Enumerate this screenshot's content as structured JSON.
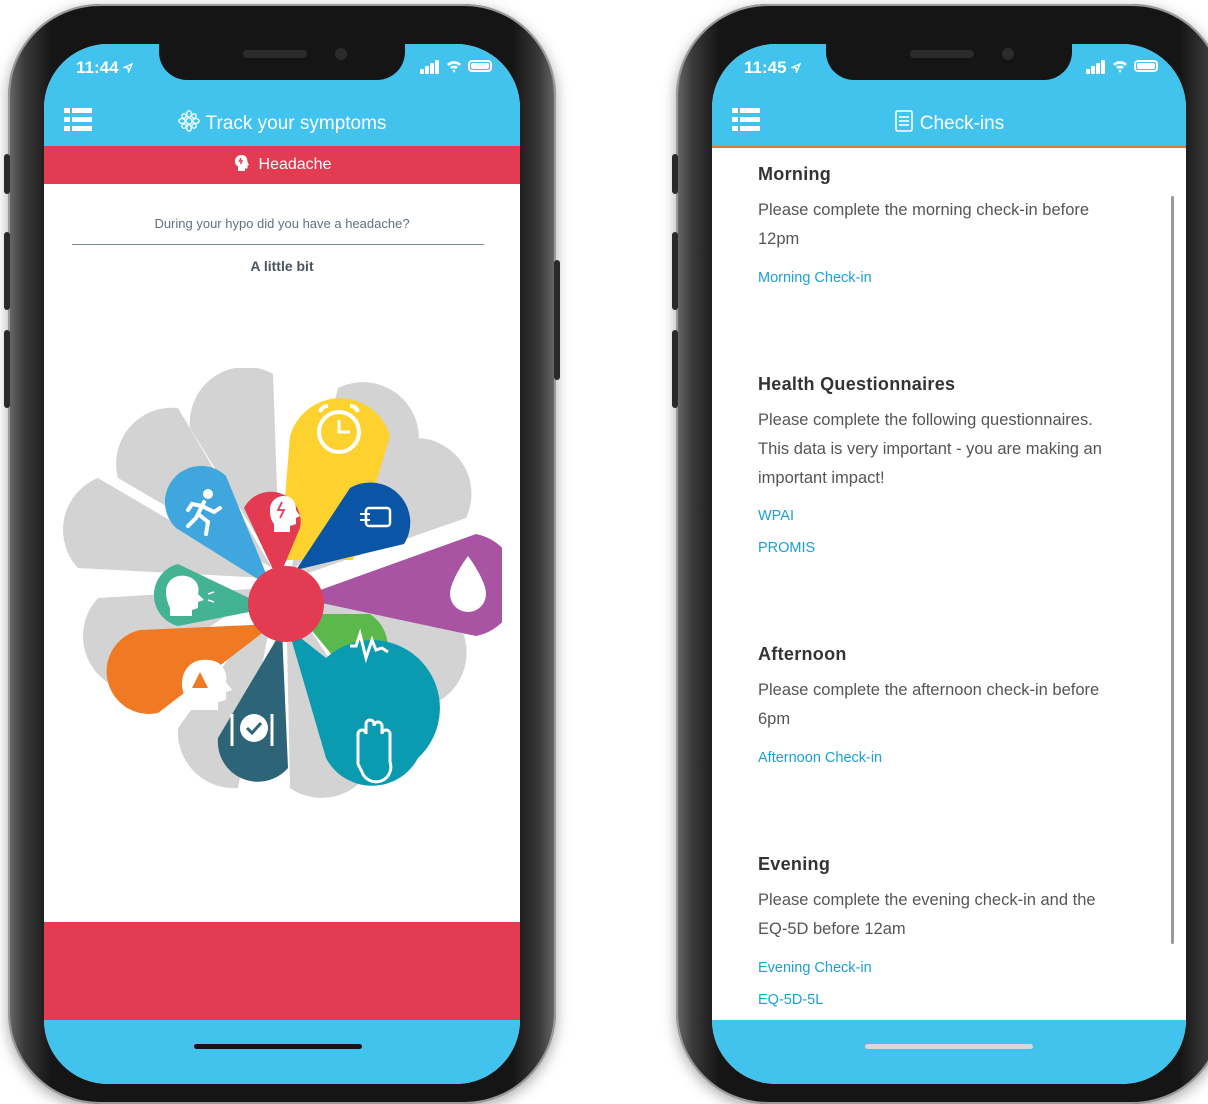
{
  "phone_left": {
    "status_time": "11:44",
    "header_title": "Track your symptoms",
    "subheader_title": "Headache",
    "question": "During your hypo did you have a headache?",
    "answer": "A little bit",
    "symptom_wheel": {
      "center_color": "#e23b52",
      "petals": [
        {
          "icon": "alarm-clock-icon",
          "color": "#fdd22e"
        },
        {
          "icon": "hand-tremor-icon",
          "color": "#0a55a5"
        },
        {
          "icon": "blood-drop-icon",
          "color": "#a953a3"
        },
        {
          "icon": "heartbeat-icon",
          "color": "#5bb84a"
        },
        {
          "icon": "sweating-hand-icon",
          "color": "#0b9bb0"
        },
        {
          "icon": "hunger-plate-icon",
          "color": "#2e6477"
        },
        {
          "icon": "confusion-warning-icon",
          "color": "#f07a24"
        },
        {
          "icon": "speech-icon",
          "color": "#44b393"
        },
        {
          "icon": "running-person-icon",
          "color": "#3fa7dd"
        },
        {
          "icon": "headache-icon",
          "color": "#e23b52"
        }
      ]
    }
  },
  "phone_right": {
    "status_time": "11:45",
    "header_title": "Check-ins",
    "sections": [
      {
        "title": "Morning",
        "text_lines": [
          "Please complete the morning check-in before",
          "12pm"
        ],
        "links": [
          "Morning Check-in"
        ]
      },
      {
        "title": "Health Questionnaires",
        "text_lines": [
          "Please complete the following questionnaires.",
          "This data is very important - you are making an",
          "important impact!"
        ],
        "links": [
          "WPAI",
          "PROMIS"
        ]
      },
      {
        "title": "Afternoon",
        "text_lines": [
          "Please complete the afternoon check-in before",
          "6pm"
        ],
        "links": [
          "Afternoon Check-in"
        ]
      },
      {
        "title": "Evening",
        "text_lines": [
          "Please complete the evening check-in and the",
          "EQ-5D before 12am"
        ],
        "links": [
          "Evening Check-in",
          "EQ-5D-5L"
        ]
      }
    ]
  },
  "colors": {
    "header_blue": "#41c3ee",
    "accent_red": "#e23b52",
    "link_blue": "#1aa0d8",
    "petal_gray": "#d3d3d3"
  }
}
